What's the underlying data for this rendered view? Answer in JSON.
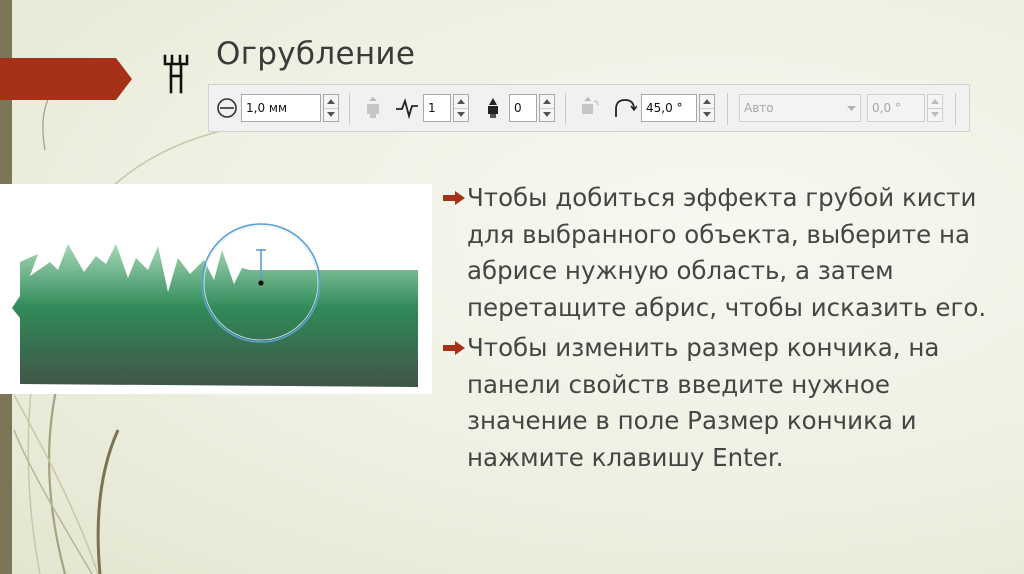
{
  "slide": {
    "title": "Огрубление",
    "bullets": [
      "Чтобы добиться эффекта грубой кисти для выбранного объекта, выберите на абрисе нужную область, а затем перетащите абрис, чтобы исказить его.",
      "Чтобы изменить размер кончика, на панели свойств введите нужное значение в поле Размер кончика и нажмите клавишу Enter."
    ]
  },
  "toolbar": {
    "nib_size": "1,0 мм",
    "frequency": "1",
    "dryout": "0",
    "bearing": "45,0 °",
    "tilt_mode": "Авто",
    "tilt_value": "0,0 °"
  },
  "colors": {
    "accent_red": "#a63119",
    "strip": "#7d7558",
    "shape_top": "#9fd4b0",
    "shape_mid": "#2f8a58",
    "shape_bottom": "#415447",
    "brush_circle": "#5a9fd2"
  },
  "icons": [
    "roughen-tool-icon",
    "nib-size-icon",
    "pressure-icon",
    "frequency-icon",
    "dryout-icon",
    "tilt-icon",
    "bearing-icon",
    "chevron-down-icon",
    "arrow-bullet-icon"
  ]
}
